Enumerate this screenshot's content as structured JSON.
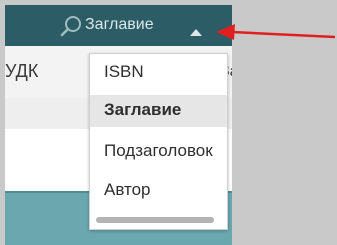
{
  "toolbar": {
    "search_icon": "search-icon",
    "field_selector_value": "Заглавие",
    "caret_icon": "caret-up-icon"
  },
  "table": {
    "columns": [
      "УДК",
      "Загл"
    ]
  },
  "dropdown": {
    "options": [
      {
        "label": "ISBN",
        "selected": false
      },
      {
        "label": "Заглавие",
        "selected": true
      },
      {
        "label": "Подзаголовок",
        "selected": false
      },
      {
        "label": "Автор",
        "selected": false
      }
    ]
  },
  "colors": {
    "toolbar_bg": "#2c5d66",
    "annotation_arrow": "#e02020",
    "teal_block": "#6aa7ae"
  }
}
